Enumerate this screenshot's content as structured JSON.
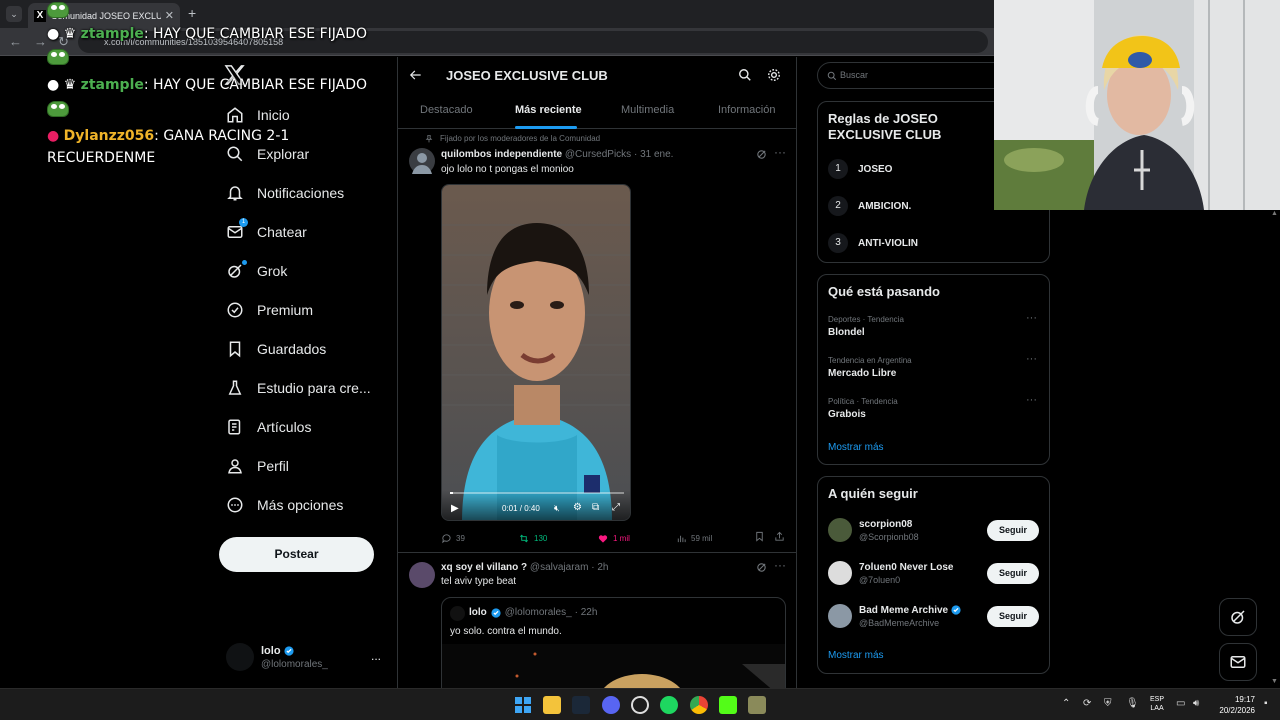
{
  "browser": {
    "tab_title": "Comunidad JOSEO EXCLUSIVE",
    "url": "x.com/i/communities/1851039546407805158"
  },
  "stream_chat": [
    {
      "user": "ztample",
      "message": "HAY QUE CAMBIAR ESE FIJADO"
    },
    {
      "user": "ztample",
      "message": "HAY QUE CAMBIAR ESE FIJADO"
    },
    {
      "user": "Dylanzz056",
      "message": "GANA RACING 2-1 RECUERDENME"
    }
  ],
  "left_nav": {
    "items": [
      {
        "label": "Inicio",
        "icon": "home-icon"
      },
      {
        "label": "Explorar",
        "icon": "search-icon"
      },
      {
        "label": "Notificaciones",
        "icon": "bell-icon"
      },
      {
        "label": "Chatear",
        "icon": "envelope-icon",
        "badge": "1"
      },
      {
        "label": "Grok",
        "icon": "grok-icon"
      },
      {
        "label": "Premium",
        "icon": "verified-icon"
      },
      {
        "label": "Guardados",
        "icon": "bookmark-icon"
      },
      {
        "label": "Estudio para cre...",
        "icon": "flask-icon"
      },
      {
        "label": "Artículos",
        "icon": "article-icon"
      },
      {
        "label": "Perfil",
        "icon": "person-icon"
      },
      {
        "label": "Más opciones",
        "icon": "more-circle-icon"
      }
    ],
    "post_button": "Postear",
    "account": {
      "name": "lolo",
      "handle": "@lolomorales_",
      "more": "..."
    }
  },
  "community": {
    "title": "JOSEO EXCLUSIVE CLUB",
    "tabs": [
      "Destacado",
      "Más reciente",
      "Multimedia",
      "Información"
    ],
    "active_tab": "Más reciente",
    "pinned_label": "Fijado por los moderadores de la Comunidad"
  },
  "tweets": [
    {
      "name": "quilombos independiente",
      "handle": "@CursedPicks",
      "time": "· 31 ene.",
      "text": "ojo lolo no t pongas el monioo",
      "video_time": "0:01 / 0:40",
      "replies": "39",
      "retweets": "130",
      "likes": "1 mil",
      "views": "59 mil"
    },
    {
      "name": "xq soy el villano ?",
      "handle": "@salvajaram",
      "time": "· 2h",
      "text": "tel aviv type beat",
      "quote": {
        "name": "lolo",
        "handle": "@lolomorales_",
        "time": "· 22h",
        "text": "yo solo. contra el mundo."
      }
    }
  ],
  "right": {
    "search_placeholder": "Buscar",
    "rules_title": "Reglas de JOSEO EXCLUSIVE CLUB",
    "rules": [
      {
        "num": "1",
        "text": "JOSEO"
      },
      {
        "num": "2",
        "text": "AMBICION."
      },
      {
        "num": "3",
        "text": "ANTI-VIOLIN"
      }
    ],
    "trends_title": "Qué está pasando",
    "trends": [
      {
        "category": "Deportes · Tendencia",
        "title": "Blondel"
      },
      {
        "category": "Tendencia en Argentina",
        "title": "Mercado Libre"
      },
      {
        "category": "Política · Tendencia",
        "title": "Grabois"
      }
    ],
    "show_more": "Mostrar más",
    "follow_title": "A quién seguir",
    "follow": [
      {
        "name": "scorpion08",
        "handle": "@Scorpionb08",
        "verified": false
      },
      {
        "name": "7oluen0 Never Lose",
        "handle": "@7oluen0",
        "verified": false
      },
      {
        "name": "Bad Meme Archive",
        "handle": "@BadMemeArchive",
        "verified": true
      }
    ],
    "follow_button": "Seguir"
  },
  "taskbar": {
    "lang": "ESP",
    "lang2": "LAA",
    "time": "19:17",
    "date": "20/2/2026"
  },
  "colors": {
    "accent": "#1d9bf0",
    "like": "#f91880",
    "retweet": "#00ba7c",
    "background": "#000000"
  }
}
